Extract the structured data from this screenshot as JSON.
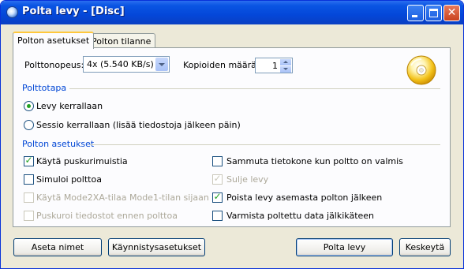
{
  "window": {
    "title": "Polta levy - [Disc]"
  },
  "tabs": [
    {
      "label": "Polton asetukset",
      "active": true
    },
    {
      "label": "Polton tilanne",
      "active": false
    }
  ],
  "speed": {
    "label": "Polttonopeus:",
    "value": "4x (5.540 KB/s)"
  },
  "copies": {
    "label": "Kopioiden määrä:",
    "value": "1"
  },
  "write_mode": {
    "title": "Polttotapa",
    "options": [
      {
        "label": "Levy kerrallaan",
        "selected": true
      },
      {
        "label": "Sessio kerrallaan (lisää tiedostoja jälkeen päin)",
        "selected": false
      }
    ]
  },
  "settings": {
    "title": "Polton asetukset",
    "left": [
      {
        "label": "Käytä puskurimuistia",
        "checked": true,
        "enabled": true
      },
      {
        "label": "Simuloi polttoa",
        "checked": false,
        "enabled": true
      },
      {
        "label": "Käytä Mode2XA-tilaa Mode1-tilan sijaan",
        "checked": false,
        "enabled": false
      },
      {
        "label": "Puskuroi tiedostot ennen polttoa",
        "checked": false,
        "enabled": false
      }
    ],
    "right": [
      {
        "label": "Sammuta tietokone kun poltto on valmis",
        "checked": false,
        "enabled": true
      },
      {
        "label": "Sulje levy",
        "checked": true,
        "enabled": false
      },
      {
        "label": "Poista levy asemasta polton jälkeen",
        "checked": true,
        "enabled": true
      },
      {
        "label": "Varmista poltettu data jälkikäteen",
        "checked": false,
        "enabled": true
      }
    ]
  },
  "buttons": {
    "set_names": "Aseta nimet",
    "boot_settings": "Käynnistysasetukset",
    "burn": "Polta levy",
    "cancel": "Keskeytä"
  }
}
